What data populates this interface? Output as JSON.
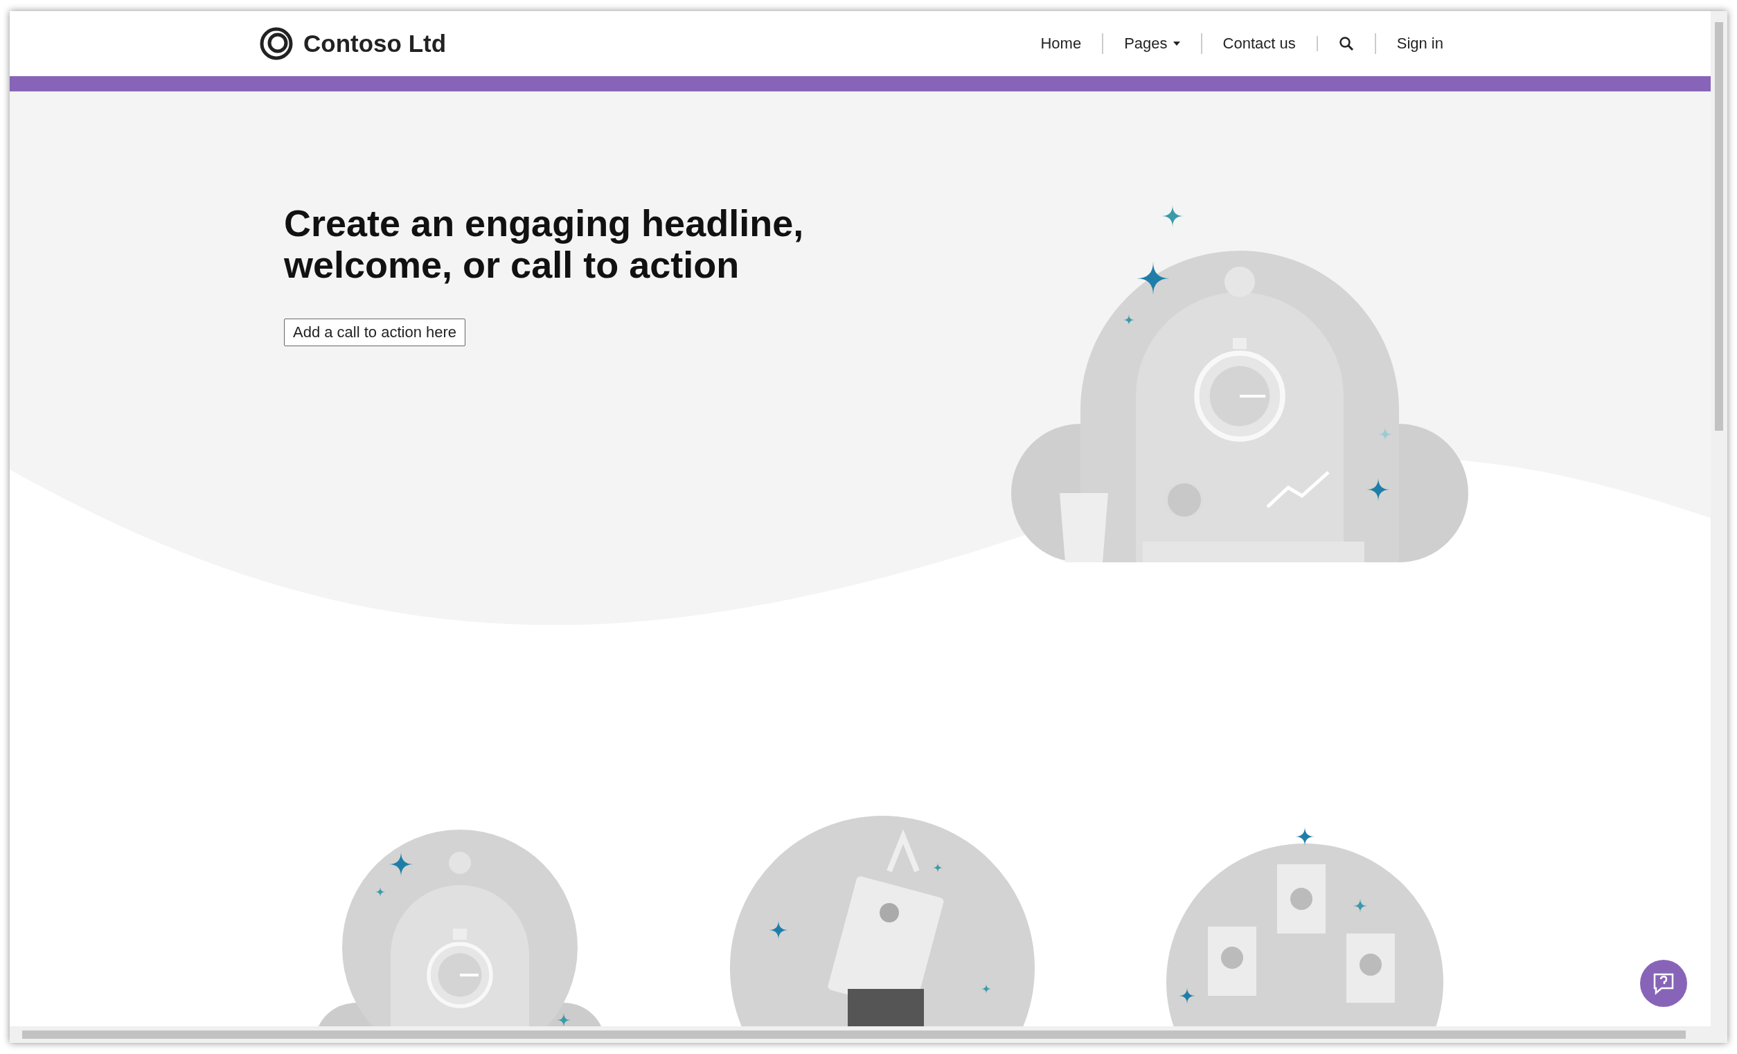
{
  "header": {
    "brand": "Contoso Ltd",
    "nav": [
      {
        "kind": "link",
        "label": "Home"
      },
      {
        "kind": "dropdown",
        "label": "Pages"
      },
      {
        "kind": "link",
        "label": "Contact us"
      },
      {
        "kind": "search"
      },
      {
        "kind": "link",
        "label": "Sign in"
      }
    ]
  },
  "hero": {
    "headline": [
      "Create an engaging headline,",
      "welcome, or call to action"
    ],
    "button": "Add a call to action here"
  },
  "features": [
    {
      "kind": "stopwatch"
    },
    {
      "kind": "folder"
    },
    {
      "kind": "cards"
    }
  ]
}
